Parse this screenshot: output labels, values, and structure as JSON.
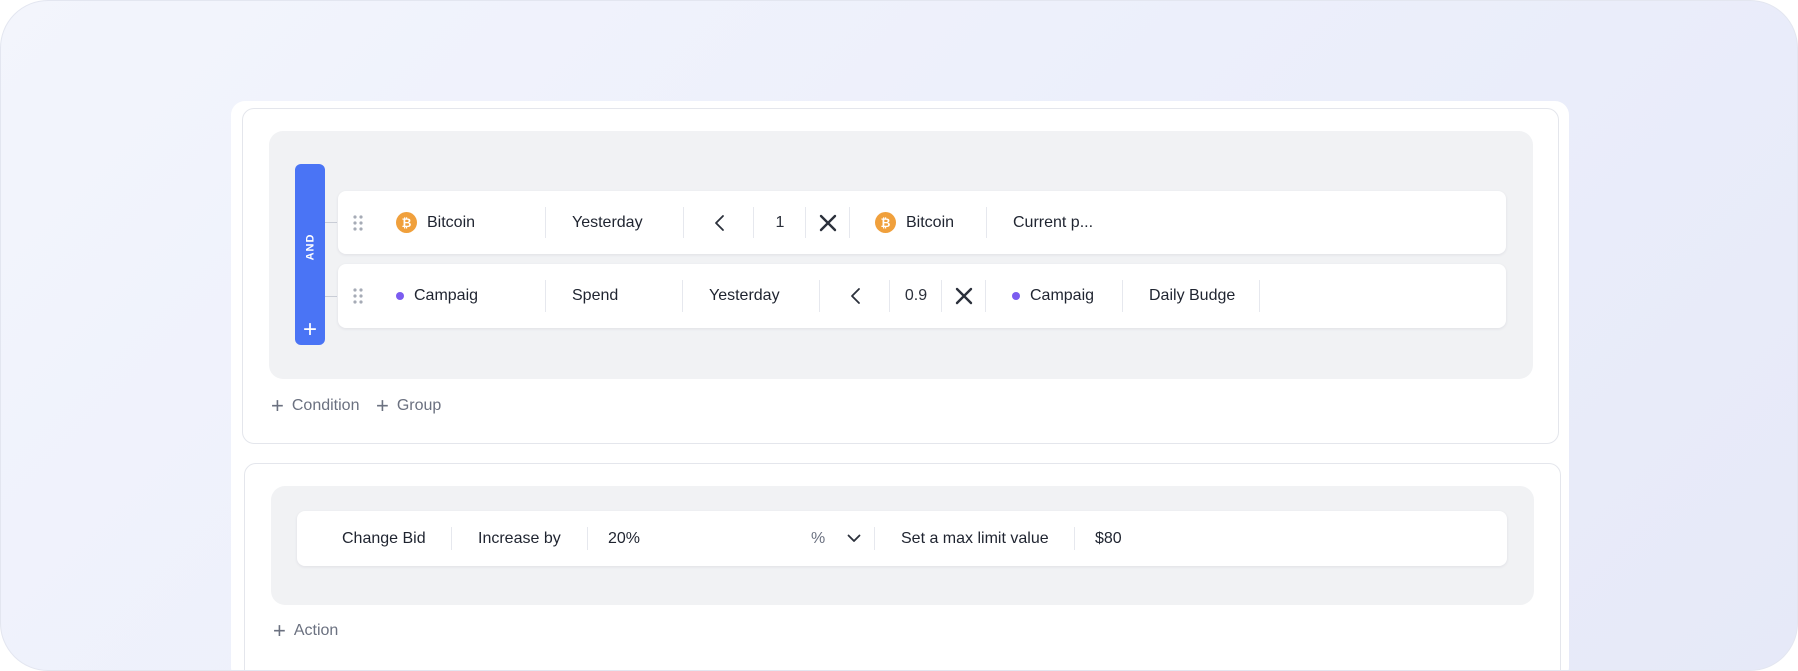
{
  "group": {
    "operator_label": "AND",
    "add_icon": "plus-icon"
  },
  "conditions": [
    {
      "source_icon": "bitcoin-icon",
      "source": "Bitcoin",
      "period": "Yesterday",
      "comparator_icon": "less-than-icon",
      "multiplier": "1",
      "times_icon": "times-icon",
      "target_icon": "bitcoin-icon",
      "target_source": "Bitcoin",
      "target_metric": "Current p..."
    },
    {
      "source_icon": "campaign-dot-icon",
      "source": "Campaig",
      "metric": "Spend",
      "period": "Yesterday",
      "comparator_icon": "less-than-icon",
      "multiplier": "0.9",
      "times_icon": "times-icon",
      "target_icon": "campaign-dot-icon",
      "target_source": "Campaig",
      "target_metric": "Daily Budge"
    }
  ],
  "condition_links": {
    "add_condition": "Condition",
    "add_group": "Group"
  },
  "action": {
    "type": "Change Bid",
    "mode": "Increase by",
    "value": "20%",
    "unit": "%",
    "unit_dropdown_icon": "chevron-down-icon",
    "limit_label": "Set a max limit value",
    "limit_value": "$80"
  },
  "action_links": {
    "add_action": "Action"
  },
  "colors": {
    "accent": "#4a74f5",
    "bitcoin": "#f0a03c",
    "campaign_dot": "#7b5cf0"
  }
}
